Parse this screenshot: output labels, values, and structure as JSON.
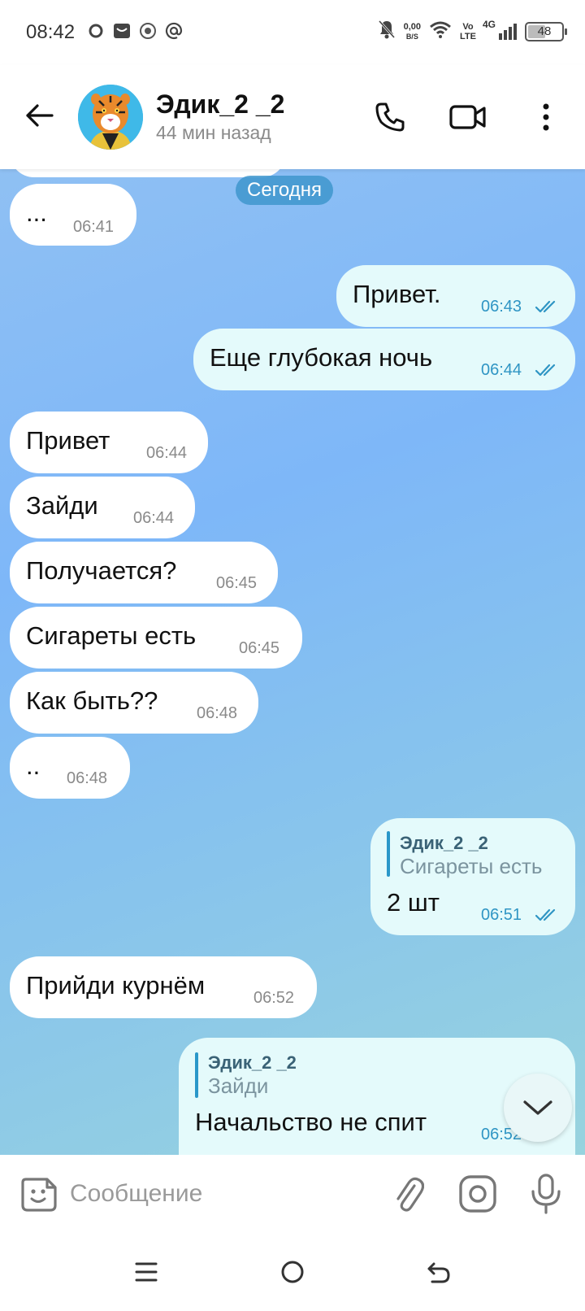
{
  "status_bar": {
    "time": "08:42",
    "net_speed_value": "0,00",
    "net_speed_unit": "B/S",
    "volte_top": "Vo",
    "volte_bottom": "LTE",
    "network": "4G",
    "battery": "48"
  },
  "header": {
    "title": "Эдик_2 _2",
    "subtitle": "44 мин назад"
  },
  "date_separator": "Сегодня",
  "messages": [
    {
      "dir": "in",
      "text": "...",
      "time": "06:41"
    },
    {
      "dir": "out",
      "text": "Привет.",
      "time": "06:43"
    },
    {
      "dir": "out",
      "text": "Еще глубокая ночь",
      "time": "06:44"
    },
    {
      "dir": "in",
      "text": "Привет",
      "time": "06:44"
    },
    {
      "dir": "in",
      "text": "Зайди",
      "time": "06:44"
    },
    {
      "dir": "in",
      "text": "Получается?",
      "time": "06:45"
    },
    {
      "dir": "in",
      "text": "Сигареты есть",
      "time": "06:45"
    },
    {
      "dir": "in",
      "text": "Как быть??",
      "time": "06:48"
    },
    {
      "dir": "in",
      "text": "..",
      "time": "06:48"
    },
    {
      "dir": "out",
      "text": "2 шт",
      "time": "06:51",
      "reply_name": "Эдик_2 _2",
      "reply_text": "Сигареты есть"
    },
    {
      "dir": "in",
      "text": "Прийди курнём",
      "time": "06:52"
    },
    {
      "dir": "out",
      "text": "Начальство не спит",
      "time": "06:52",
      "reply_name": "Эдик_2 _2",
      "reply_text": "Зайди"
    }
  ],
  "input": {
    "placeholder": "Сообщение"
  },
  "icons": {
    "back": "arrow-left-icon",
    "call": "phone-icon",
    "video": "video-camera-icon",
    "more": "more-vertical-icon",
    "emoji": "sticker-icon",
    "attach": "paperclip-icon",
    "camera": "camera-icon",
    "mic": "microphone-icon",
    "scroll_down": "chevron-down-icon"
  },
  "colors": {
    "accent": "#2f95c4",
    "outgoing_bubble": "#e4fafb",
    "incoming_bubble": "#ffffff",
    "date_pill": "#3e96cd"
  }
}
